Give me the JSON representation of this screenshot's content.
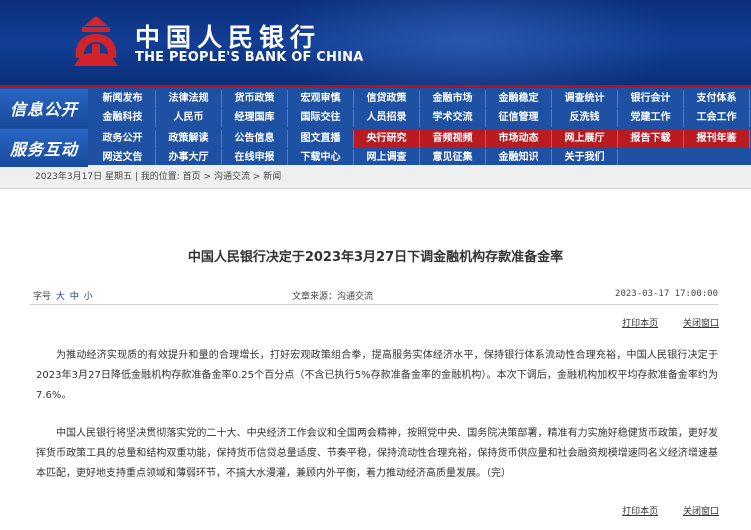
{
  "header": {
    "title_cn": "中国人民银行",
    "title_en": "THE PEOPLE'S BANK OF CHINA",
    "logo_icon": "pboc-emblem-icon"
  },
  "nav": {
    "section1_label": "信息公开",
    "section2_label": "服务互动",
    "row1": [
      "新闻发布",
      "法律法规",
      "货币政策",
      "宏观审慎",
      "信贷政策",
      "金融市场",
      "金融稳定",
      "调查统计",
      "银行会计",
      "支付体系"
    ],
    "row2": [
      "金融科技",
      "人民币",
      "经理国库",
      "国际交往",
      "人员招录",
      "学术交流",
      "征信管理",
      "反洗钱",
      "党建工作",
      "工会工作"
    ],
    "row3": [
      "政务公开",
      "政策解读",
      "公告信息",
      "图文直播",
      "央行研究",
      "音频视频",
      "市场动态",
      "网上展厅",
      "报告下载",
      "报刊年鉴"
    ],
    "row4": [
      "网送文告",
      "办事大厅",
      "在线申报",
      "下载中心",
      "网上调查",
      "意见征集",
      "金融知识",
      "关于我们"
    ],
    "highlight_color": "#b81c22"
  },
  "breadcrumb": {
    "date": "2023年3月17日 星期五",
    "prefix": "我的位置:",
    "home": "首页",
    "sep": ">",
    "level1": "沟通交流",
    "level2": "新闻"
  },
  "article": {
    "title": "中国人民银行决定于2023年3月27日下调金融机构存款准备金率",
    "font_size_label": "字号",
    "font_large": "大",
    "font_medium": "中",
    "font_small": "小",
    "source": "文章来源：沟通交流",
    "datetime": "2023-03-17 17:00:00",
    "print_label": "打印本页",
    "close_label": "关闭窗口",
    "paragraph1": "为推动经济实现质的有效提升和量的合理增长，打好宏观政策组合拳，提高服务实体经济水平，保持银行体系流动性合理充裕，中国人民银行决定于2023年3月27日降低金融机构存款准备金率0.25个百分点（不含已执行5%存款准备金率的金融机构）。本次下调后，金融机构加权平均存款准备金率约为7.6%。",
    "paragraph2": "中国人民银行将坚决贯彻落实党的二十大、中央经济工作会议和全国两会精神，按照党中央、国务院决策部署，精准有力实施好稳健货币政策，更好发挥货币政策工具的总量和结构双重功能，保持货币信贷总量适度、节奏平稳，保持流动性合理充裕，保持货币供应量和社会融资规模增速同名义经济增速基本匹配，更好地支持重点领域和薄弱环节，不搞大水漫灌，兼顾内外平衡，着力推动经济高质量发展。（完）"
  }
}
